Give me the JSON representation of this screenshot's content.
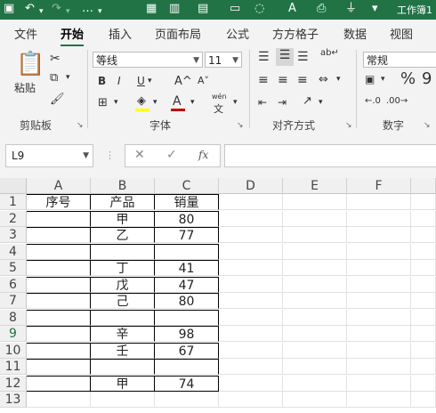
{
  "titlebar": {
    "title": "工作簿1"
  },
  "tabs": [
    "文件",
    "开始",
    "插入",
    "页面布局",
    "公式",
    "方方格子",
    "数据",
    "视图"
  ],
  "active_tab": "开始",
  "ribbon": {
    "clipboard": {
      "paste_label": "粘贴",
      "group_label": "剪贴板"
    },
    "font": {
      "font_name": "等线",
      "font_size": "11",
      "bold": "B",
      "italic": "I",
      "underline": "U",
      "grow": "A^",
      "shrink": "A˅",
      "wen": "wén",
      "wen_char": "文",
      "group_label": "字体"
    },
    "alignment": {
      "group_label": "对齐方式"
    },
    "number": {
      "format": "常规",
      "percent": "%",
      "comma": "9",
      "group_label": "数字"
    }
  },
  "formula_bar": {
    "name_box": "L9",
    "fx": "fx",
    "value": ""
  },
  "columns": [
    "A",
    "B",
    "C",
    "D",
    "E",
    "F"
  ],
  "rows": [
    {
      "num": "1",
      "cells": [
        "序号",
        "产品",
        "销量",
        "",
        "",
        ""
      ]
    },
    {
      "num": "2",
      "cells": [
        "",
        "甲",
        "80",
        "",
        "",
        ""
      ]
    },
    {
      "num": "3",
      "cells": [
        "",
        "乙",
        "77",
        "",
        "",
        ""
      ]
    },
    {
      "num": "4",
      "cells": [
        "",
        "",
        "",
        "",
        "",
        ""
      ]
    },
    {
      "num": "5",
      "cells": [
        "",
        "丁",
        "41",
        "",
        "",
        ""
      ]
    },
    {
      "num": "6",
      "cells": [
        "",
        "戊",
        "47",
        "",
        "",
        ""
      ]
    },
    {
      "num": "7",
      "cells": [
        "",
        "己",
        "80",
        "",
        "",
        ""
      ]
    },
    {
      "num": "8",
      "cells": [
        "",
        "",
        "",
        "",
        "",
        ""
      ]
    },
    {
      "num": "9",
      "cells": [
        "",
        "辛",
        "98",
        "",
        "",
        ""
      ]
    },
    {
      "num": "10",
      "cells": [
        "",
        "壬",
        "67",
        "",
        "",
        ""
      ]
    },
    {
      "num": "11",
      "cells": [
        "",
        "",
        "",
        "",
        "",
        ""
      ]
    },
    {
      "num": "12",
      "cells": [
        "",
        "甲",
        "74",
        "",
        "",
        ""
      ]
    },
    {
      "num": "13",
      "cells": [
        "",
        "",
        "",
        "",
        "",
        ""
      ]
    }
  ],
  "selected_row": "9",
  "colors": {
    "brand": "#217346",
    "font_color": "#c00000",
    "highlight": "#ffff00"
  }
}
